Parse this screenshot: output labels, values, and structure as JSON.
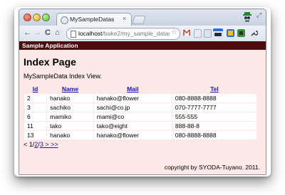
{
  "browser": {
    "tab_title": "MySampleDatas",
    "tab_close": "×",
    "url_host": "localhost",
    "url_path": "/bake2/my_sample_datas...",
    "nav": {
      "back": "←",
      "forward": "→",
      "reload": "C",
      "home": "⌂"
    },
    "star": "☆"
  },
  "app": {
    "bar_title": "Sample Application",
    "heading": "Index Page",
    "subtitle": "MySampleData Index View."
  },
  "table": {
    "columns": [
      "Id",
      "Name",
      "Mail",
      "Tel"
    ],
    "rows": [
      [
        "2",
        "hanako",
        "hanako@flower",
        "080-8888-8888"
      ],
      [
        "3",
        "sachiko",
        "sachi@co.jp",
        "070-7777-7777"
      ],
      [
        "6",
        "mamiko",
        "mami@co",
        "555-555"
      ],
      [
        "11",
        "tako",
        "tako@eight",
        "888-88-8"
      ],
      [
        "13",
        "hanako",
        "hanako@flower",
        "080-8888-8888"
      ]
    ]
  },
  "pager": {
    "prev": "< 1",
    "sep1": "/",
    "page2": "2",
    "sep2": "/",
    "page3": "3",
    "next": " > >>"
  },
  "footer": "copyright by SYODA-Tuyano. 2011.",
  "colors": {
    "page_bg": "#fde8e8",
    "app_bar": "#4a0c0c",
    "link": "#1414b8"
  }
}
